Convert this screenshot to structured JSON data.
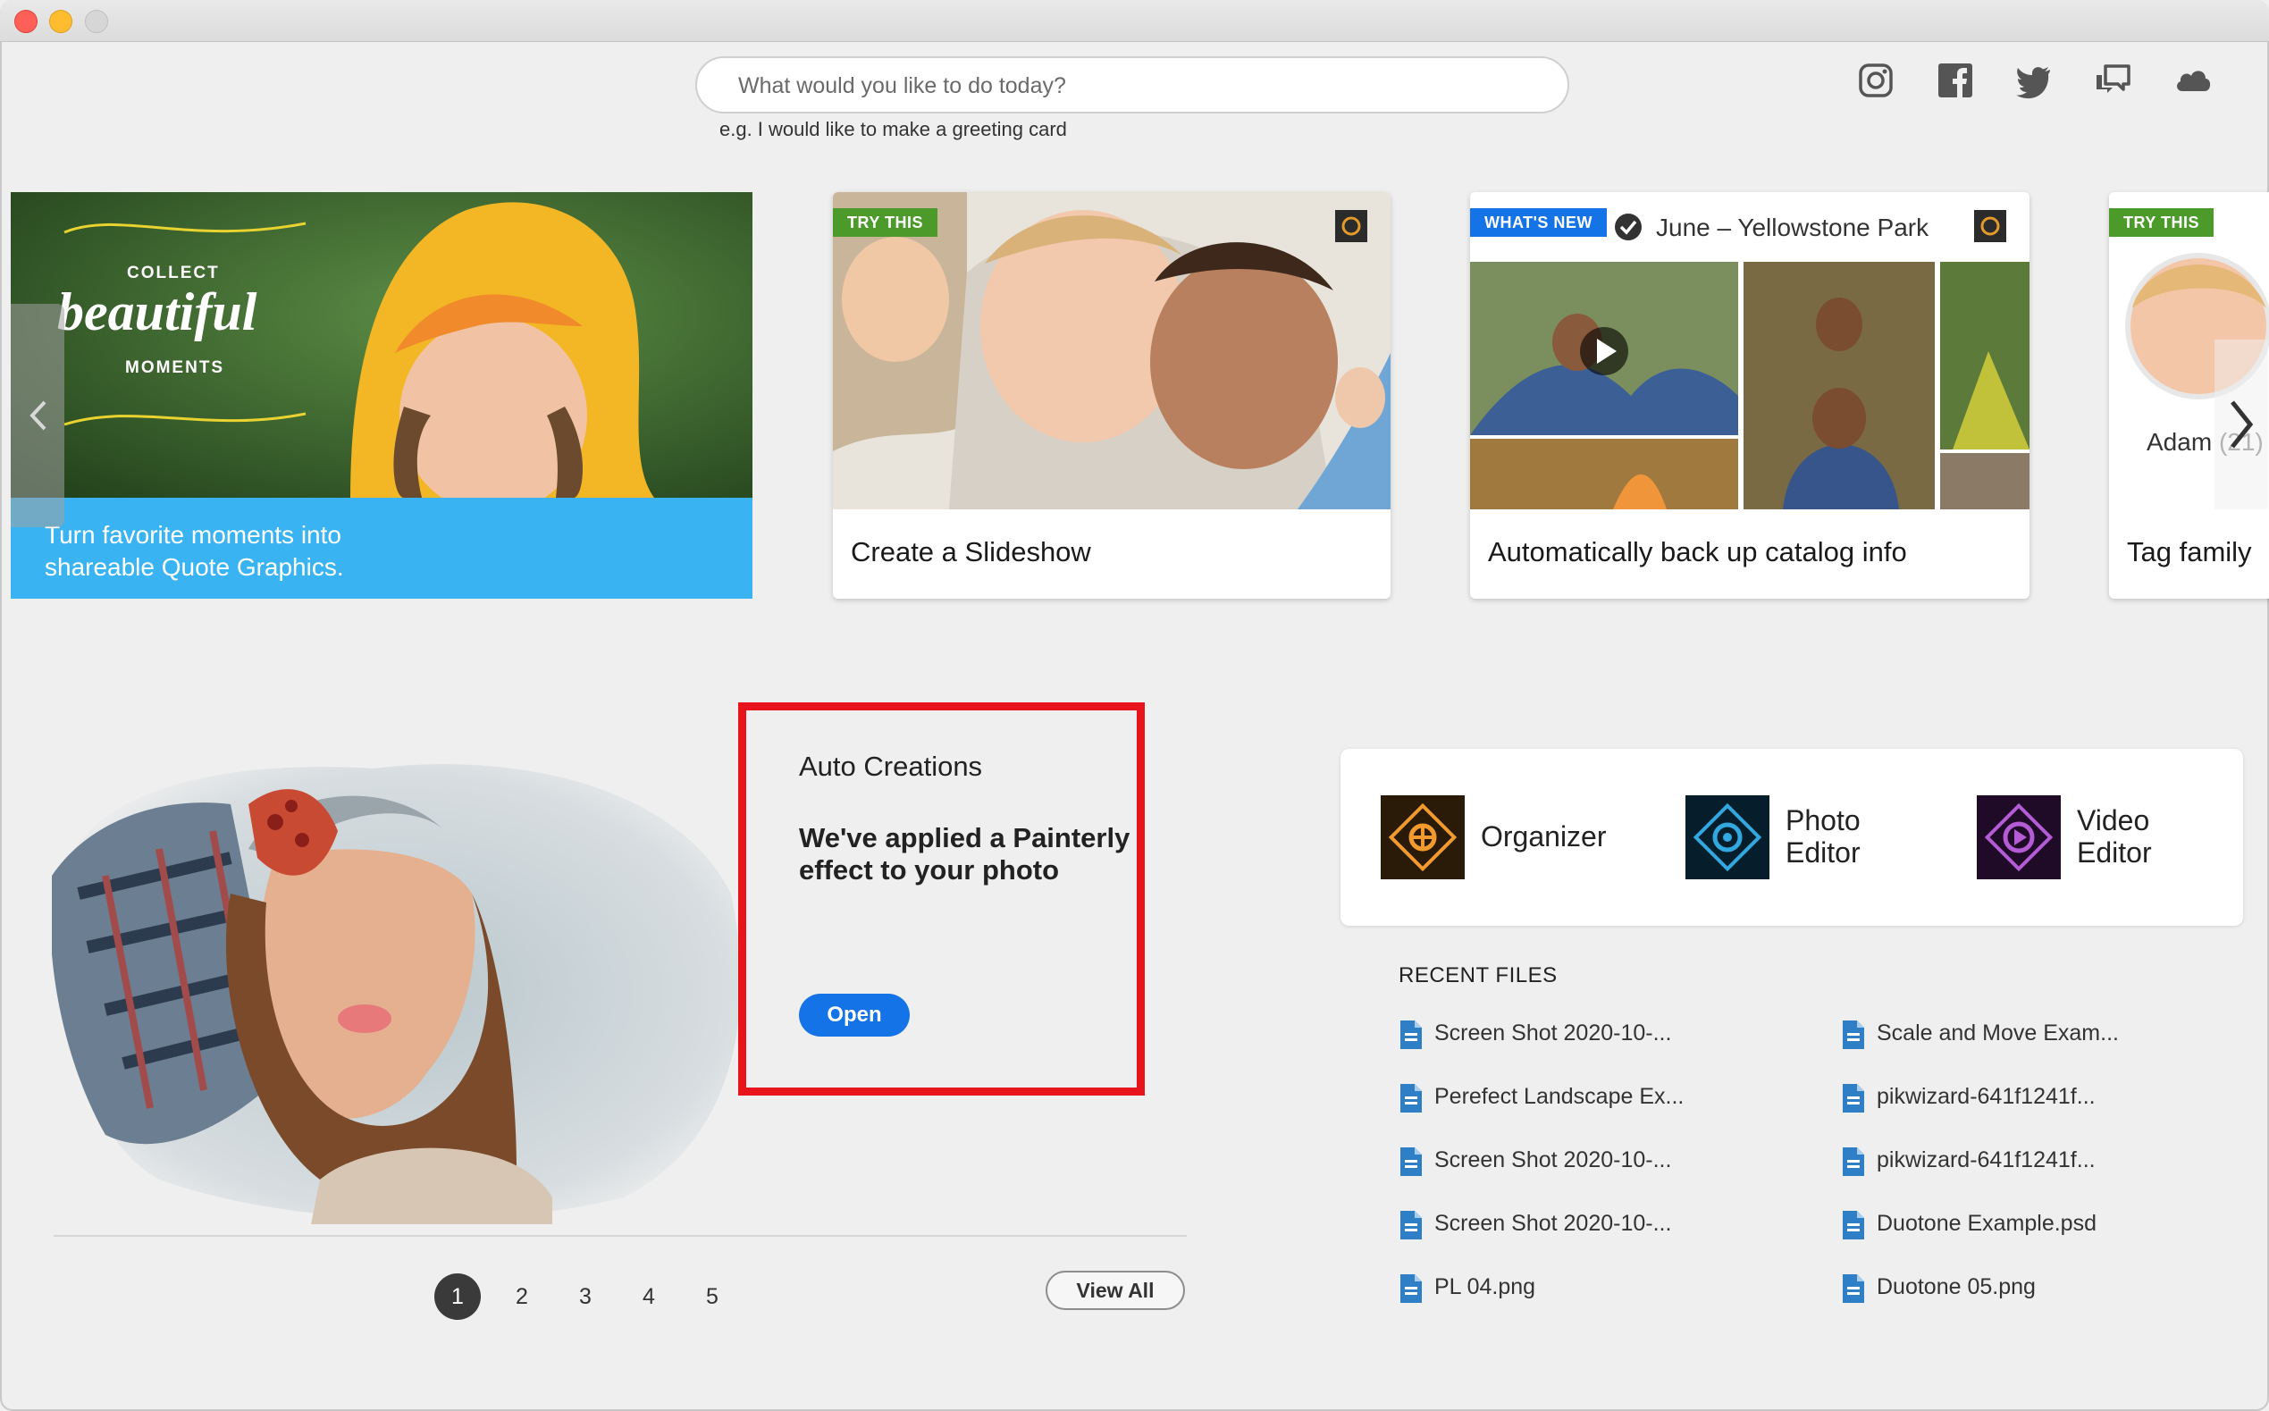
{
  "search": {
    "placeholder": "What would you like to do today?",
    "hint": "e.g. I would like to make a greeting card"
  },
  "social_icons": [
    "instagram-icon",
    "facebook-icon",
    "twitter-icon",
    "community-icon",
    "cloud-icon"
  ],
  "carousel": {
    "hero": {
      "line1": "Turn favorite moments into",
      "line2": "shareable Quote Graphics.",
      "art_top": "COLLECT",
      "art_mid": "beautiful",
      "art_bottom": "MOMENTS"
    },
    "cards": [
      {
        "tag": "TRY THIS",
        "caption": "Create a Slideshow"
      },
      {
        "tag": "WHAT'S NEW",
        "album": "June – Yellowstone Park",
        "caption": "Automatically back up catalog info"
      },
      {
        "tag": "TRY THIS",
        "person": "Adam",
        "person_count": "(21)",
        "caption": "Tag family"
      }
    ]
  },
  "auto_creations": {
    "title": "Auto Creations",
    "message": "We've applied a Painterly effect to your photo",
    "open_label": "Open",
    "pages": [
      "1",
      "2",
      "3",
      "4",
      "5"
    ],
    "active_page": "1",
    "view_all_label": "View All"
  },
  "apps": [
    {
      "name": "Organizer",
      "icon": "organizer-icon"
    },
    {
      "name_line1": "Photo",
      "name_line2": "Editor",
      "icon": "photo-editor-icon"
    },
    {
      "name_line1": "Video",
      "name_line2": "Editor",
      "icon": "video-editor-icon"
    }
  ],
  "recent_files": {
    "heading": "RECENT FILES",
    "left": [
      "Screen Shot 2020-10-...",
      "Perefect Landscape Ex...",
      "Screen Shot 2020-10-...",
      "Screen Shot 2020-10-...",
      "PL 04.png"
    ],
    "right": [
      "Scale and Move Exam...",
      "pikwizard-641f1241f...",
      "pikwizard-641f1241f...",
      "Duotone Example.psd",
      "Duotone 05.png"
    ]
  },
  "colors": {
    "accent": "#1473e6",
    "highlight_box": "#e8141c",
    "tag_green": "#4c9a2a",
    "hero_band": "#3ab3f2"
  }
}
